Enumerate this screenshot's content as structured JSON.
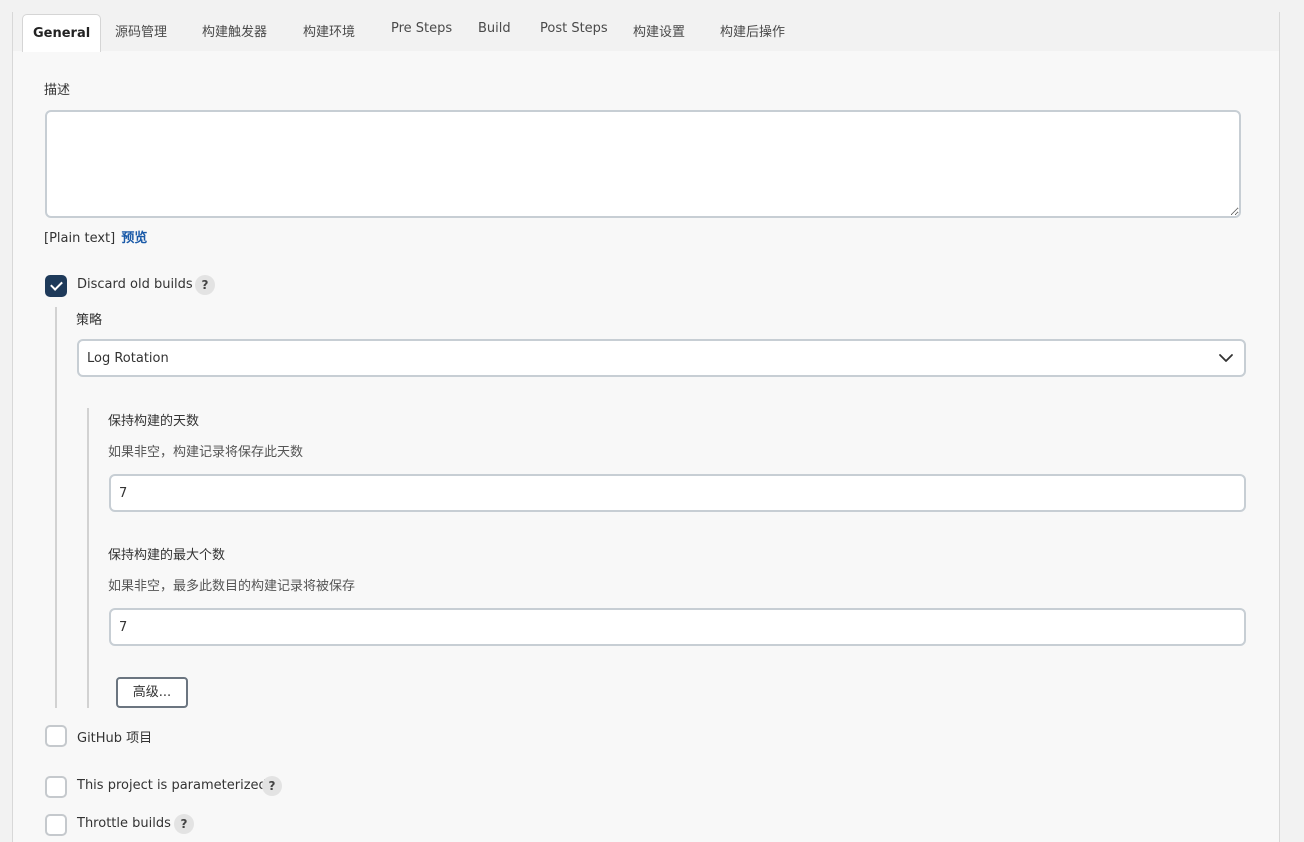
{
  "tabs": [
    "General",
    "源码管理",
    "构建触发器",
    "构建环境",
    "Pre Steps",
    "Build",
    "Post Steps",
    "构建设置",
    "构建后操作"
  ],
  "description": {
    "label": "描述",
    "value": "",
    "format_text": "[Plain text]",
    "preview_link": "预览"
  },
  "discard_old_builds": {
    "label": "Discard old builds",
    "checked": true,
    "help": "?",
    "strategy_label": "策略",
    "strategy_value": "Log Rotation",
    "days": {
      "label": "保持构建的天数",
      "hint": "如果非空，构建记录将保存此天数",
      "value": "7"
    },
    "max": {
      "label": "保持构建的最大个数",
      "hint": "如果非空，最多此数目的构建记录将被保存",
      "value": "7"
    },
    "advanced_button": "高级..."
  },
  "github_project": {
    "label": "GitHub 项目",
    "checked": false
  },
  "parameterized": {
    "label": "This project is parameterized",
    "checked": false,
    "help": "?"
  },
  "throttle": {
    "label": "Throttle builds",
    "checked": false,
    "help": "?"
  }
}
